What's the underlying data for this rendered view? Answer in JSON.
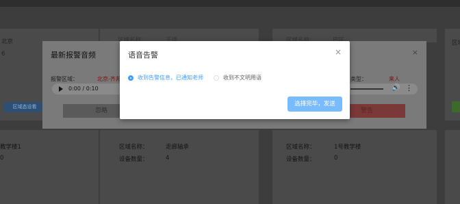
{
  "backdrop": {
    "card1_city": "北京",
    "card1_num": "6",
    "card1_btn": "区域态设看",
    "card2_label": "区域名称：",
    "card2_value": "王请",
    "card3_label": "区域名称：",
    "card3_value": "巴区",
    "card4_label": "区域",
    "bottom": [
      {
        "area_value": "教学楼1",
        "count_value": "0"
      },
      {
        "area_label": "区域名称：",
        "area_value": "走廊轴承",
        "count_label": "设备数量：",
        "count_value": "4"
      },
      {
        "area_label": "区域名称：",
        "area_value": "1号教学楼",
        "count_label": "设备数量：",
        "count_value": "0"
      }
    ]
  },
  "mid_modal": {
    "title": "最新报警音频",
    "close": "×",
    "area_label": "报警区域：",
    "area_value": "北京-齐邦",
    "type_label": "类型：",
    "type_value": "来人",
    "time": "0:00 / 0:10",
    "ignore_label": "忽略",
    "alarm_label": "警告"
  },
  "dialog": {
    "title": "语音告警",
    "close": "×",
    "options": [
      {
        "label": "收到告警信息，已通知老师",
        "checked": true
      },
      {
        "label": "收到不文明用语",
        "checked": false
      }
    ],
    "confirm_label": "选择完毕，发送"
  },
  "colors": {
    "primary": "#409eff",
    "confirm_button": "#79bbff",
    "alarm_red": "#f56c6c"
  }
}
